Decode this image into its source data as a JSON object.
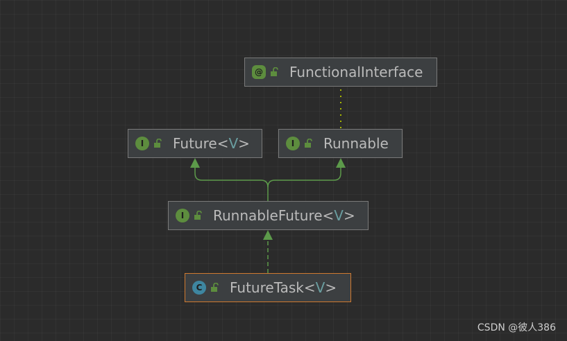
{
  "nodes": [
    {
      "id": "functional-interface",
      "kind_letter": "@",
      "name": "FunctionalInterface",
      "type_param": ""
    },
    {
      "id": "future",
      "kind_letter": "I",
      "name": "Future",
      "type_param": "V"
    },
    {
      "id": "runnable",
      "kind_letter": "I",
      "name": "Runnable",
      "type_param": ""
    },
    {
      "id": "runnable-future",
      "kind_letter": "I",
      "name": "RunnableFuture",
      "type_param": "V"
    },
    {
      "id": "future-task",
      "kind_letter": "C",
      "name": "FutureTask",
      "type_param": "V"
    }
  ],
  "edges": [
    {
      "from": "runnable",
      "to": "functional-interface",
      "kind": "annotation"
    },
    {
      "from": "runnable-future",
      "to": "future",
      "kind": "extends"
    },
    {
      "from": "runnable-future",
      "to": "runnable",
      "kind": "extends"
    },
    {
      "from": "future-task",
      "to": "runnable-future",
      "kind": "implements"
    }
  ],
  "selected_node": "future-task",
  "colors": {
    "background": "#2b2b2b",
    "node_fill": "#3c3f41",
    "node_border": "#7a7a7a",
    "selected_border": "#d07a2f",
    "interface_badge": "#5d8d3e",
    "class_badge": "#3e86a0",
    "edge_green": "#5c9a4a",
    "annotation_edge": "#a8b800",
    "type_param": "#6a9ea0"
  },
  "watermark": "CSDN @彼人386"
}
